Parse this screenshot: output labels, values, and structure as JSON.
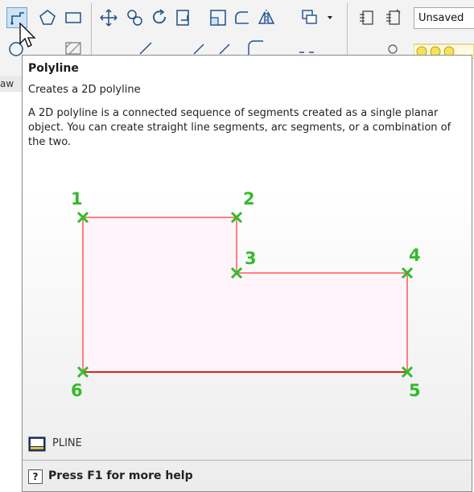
{
  "ribbon": {
    "named_view_value": "Unsaved",
    "side_tab_label": "aw",
    "tools_row1": [
      "polyline-icon",
      "polygon-icon",
      "rectangle-icon",
      "move-icon",
      "copy-icon",
      "rotate-icon",
      "scale-icon",
      "stretch-icon",
      "fillet-icon",
      "mirror-icon",
      "array-icon",
      "layer-states-icon",
      "layer-properties-icon"
    ],
    "tools_row2": [
      "circle-icon",
      "hatch-icon",
      "extend-icon",
      "trim-icon",
      "explode-icon",
      "offset-icon",
      "arc-icon",
      "join-icon",
      "layer-freeze-icon",
      "layer-color-icon"
    ]
  },
  "tooltip": {
    "title": "Polyline",
    "subtitle": "Creates a 2D polyline",
    "description": "A 2D polyline is a connected sequence of segments created as a single planar object. You can create straight line segments, arc segments, or a combination of the two.",
    "points": [
      "1",
      "2",
      "3",
      "4",
      "5",
      "6"
    ],
    "command": "PLINE",
    "command_icon": "command-icon",
    "help_icon_glyph": "?",
    "help_text": "Press F1 for more help",
    "colors": {
      "outline": "#ff7f7f",
      "fill": "#fff4f9",
      "points": "#33bb2a",
      "bottom_edge": "#dd2020"
    }
  }
}
